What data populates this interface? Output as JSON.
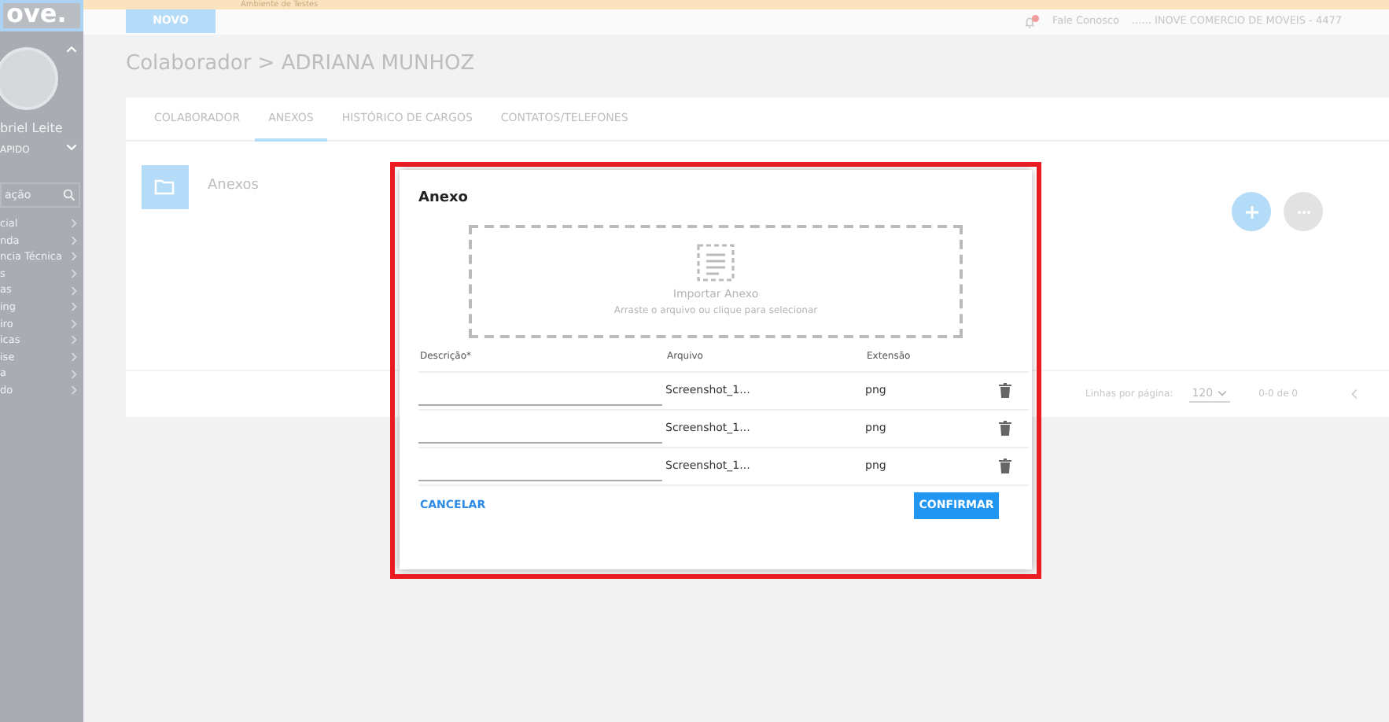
{
  "banner": {
    "text": "Ambiente de Testes"
  },
  "sidebar": {
    "logo": "ove.",
    "user_name": "briel Leite",
    "profile": "APIDO",
    "search": {
      "placeholder": "ação"
    },
    "items": [
      {
        "label": "cial"
      },
      {
        "label": "nda"
      },
      {
        "label": "ncia Técnica"
      },
      {
        "label": "s"
      },
      {
        "label": "as"
      },
      {
        "label": "ing"
      },
      {
        "label": "iro"
      },
      {
        "label": "icas"
      },
      {
        "label": "ise"
      },
      {
        "label": "a"
      },
      {
        "label": "do"
      }
    ]
  },
  "header": {
    "new_button": "NOVO",
    "contact_link": "Fale Conosco",
    "company": "...... INOVE COMERCIO DE MOVEIS - 4477"
  },
  "page": {
    "breadcrumb": "Colaborador > ADRIANA MUNHOZ",
    "tabs": [
      {
        "label": "COLABORADOR",
        "selected": false
      },
      {
        "label": "ANEXOS",
        "selected": true
      },
      {
        "label": "HISTÓRICO DE CARGOS",
        "selected": false
      },
      {
        "label": "CONTATOS/TELEFONES",
        "selected": false
      }
    ],
    "section_title": "Anexos",
    "pagination": {
      "rows_label": "Linhas por página:",
      "rows_value": "120",
      "range": "0-0 de 0"
    }
  },
  "modal": {
    "title": "Anexo",
    "dropzone": {
      "title": "Importar Anexo",
      "hint": "Arraste o arquivo ou clique para selecionar"
    },
    "columns": [
      "Descrição*",
      "Arquivo",
      "Extensão"
    ],
    "rows": [
      {
        "file": "Screenshot_1...",
        "extension": "png"
      },
      {
        "file": "Screenshot_1...",
        "extension": "png"
      },
      {
        "file": "Screenshot_1...",
        "extension": "png"
      }
    ],
    "cancel": "CANCELAR",
    "confirm": "CONFIRMAR"
  }
}
